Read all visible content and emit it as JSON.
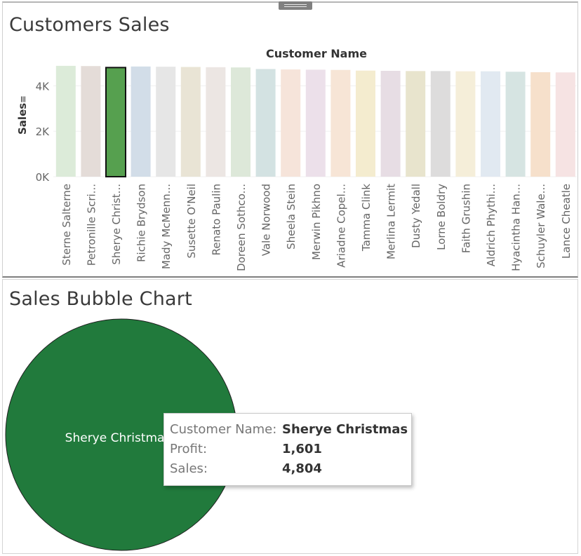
{
  "top_sheet": {
    "title": "Customers Sales"
  },
  "bottom_sheet": {
    "title": "Sales Bubble Chart"
  },
  "chart_data": [
    {
      "type": "bar",
      "title": "Customers Sales",
      "xlabel": "Customer Name",
      "ylabel": "Sales",
      "ylim": [
        0,
        5000
      ],
      "yticks": [
        {
          "value": 0,
          "label": "0K"
        },
        {
          "value": 2000,
          "label": "2K"
        },
        {
          "value": 4000,
          "label": "4K"
        }
      ],
      "grid": true,
      "categories": [
        "Sterne Salterne",
        "Petronille Scri...",
        "Sherye Christ...",
        "Richie Brydson",
        "Mady McMenn...",
        "Susette O'Neil",
        "Renato Paulin",
        "Doreen Sothco...",
        "Vale Norwood",
        "Sheela Stein",
        "Merwin Pikhno",
        "Ariadne Copel...",
        "Tamma Clink",
        "Merlina Lermit",
        "Dusty Yedall",
        "Lorne Boldry",
        "Faith Grushin",
        "Aldrich Phythi...",
        "Hyacintha Han...",
        "Schuyler Wale...",
        "Lance Cheatle"
      ],
      "values": [
        4880,
        4870,
        4804,
        4850,
        4840,
        4830,
        4820,
        4810,
        4740,
        4720,
        4710,
        4700,
        4670,
        4660,
        4650,
        4650,
        4640,
        4640,
        4620,
        4600,
        4590
      ],
      "colors": [
        "#dcebd9",
        "#e4dcd8",
        "#56a04f",
        "#d2dde8",
        "#e6e6e6",
        "#e9e4d5",
        "#ece6e3",
        "#dde8d9",
        "#d3e2e2",
        "#f6e4da",
        "#ece0ea",
        "#f7e5d6",
        "#f4eccf",
        "#e7dde4",
        "#e8e4cd",
        "#dddcdc",
        "#f5eed9",
        "#e1e9f1",
        "#d6e4e2",
        "#f6e0cb",
        "#f6e3e3"
      ],
      "highlighted": "Sherye Christ..."
    },
    {
      "type": "scatter",
      "title": "Sales Bubble Chart",
      "points": [
        {
          "label": "Sherye Christmas",
          "sales": 4804,
          "profit": 1601,
          "color": "#217a3c"
        }
      ]
    }
  ],
  "tooltip": {
    "rows": [
      {
        "key": "Customer Name:",
        "value": "Sherye Christmas"
      },
      {
        "key": "Profit:",
        "value": "1,601"
      },
      {
        "key": "Sales:",
        "value": "4,804"
      }
    ]
  },
  "sort_indicator_glyph": "≡"
}
